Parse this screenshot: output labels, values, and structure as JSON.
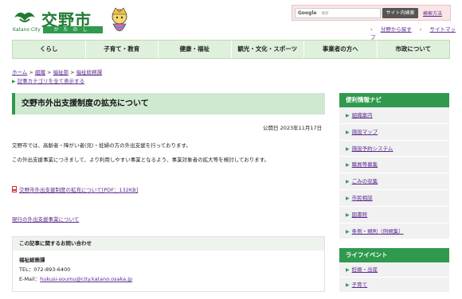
{
  "header": {
    "site_name": "交野市",
    "site_en": "Katano City",
    "site_kana": "かたのし",
    "search": {
      "google_label": "Google",
      "placeholder": "検索",
      "button_label": "サイト内検索",
      "help_label": "検索方法"
    },
    "util_links": [
      {
        "label": "分野から探す"
      },
      {
        "label": "サイトマップ"
      }
    ]
  },
  "gnav": [
    {
      "label": "くらし"
    },
    {
      "label": "子育て・教育"
    },
    {
      "label": "健康・福祉"
    },
    {
      "label": "観光・文化・スポーツ"
    },
    {
      "label": "事業者の方へ"
    },
    {
      "label": "市政について"
    }
  ],
  "breadcrumb": {
    "items": [
      "ホーム",
      "組織",
      "福祉部",
      "福祉総務課"
    ],
    "separator": ">",
    "category_link": "記事カテゴリを全て表示する"
  },
  "main": {
    "title": "交野市外出支援制度の拡充について",
    "published": "公開日 2023年11月17日",
    "paragraph1": "交野市では、高齢者・障がい者(児)・妊婦の方の外出支援を行っております。",
    "paragraph2": "この外出支援事業につきまして、より利用しやすい事業となるよう、事業対象者の拡大等を検討しております。",
    "pdf_link": "交野市外出支援制度の拡充について[PDF：132KB]",
    "current_link": "現行の外出支援事業について"
  },
  "contact": {
    "heading": "この記事に関するお問い合わせ",
    "department": "福祉総務課",
    "tel": "TEL：072-893-6400",
    "email_label": "E-Mail：",
    "email": "hukusi-soumu@city.katano.osaka.jp"
  },
  "sidebar": {
    "nav_title": "便利情報ナビ",
    "nav_items": [
      {
        "label": "組織案内"
      },
      {
        "label": "施設マップ"
      },
      {
        "label": "施設予約システム"
      },
      {
        "label": "職員等募集"
      },
      {
        "label": "ごみの収集"
      },
      {
        "label": "市民相談"
      },
      {
        "label": "図書館"
      },
      {
        "label": "条例・規則（例規集）"
      }
    ],
    "life_title": "ライフイベント",
    "life_items": [
      {
        "label": "妊娠・出産"
      },
      {
        "label": "子育て"
      }
    ]
  },
  "colors": {
    "brand_green": "#2f9a4d",
    "title_bg": "#cfe8d0",
    "link": "#5b2a8f"
  }
}
